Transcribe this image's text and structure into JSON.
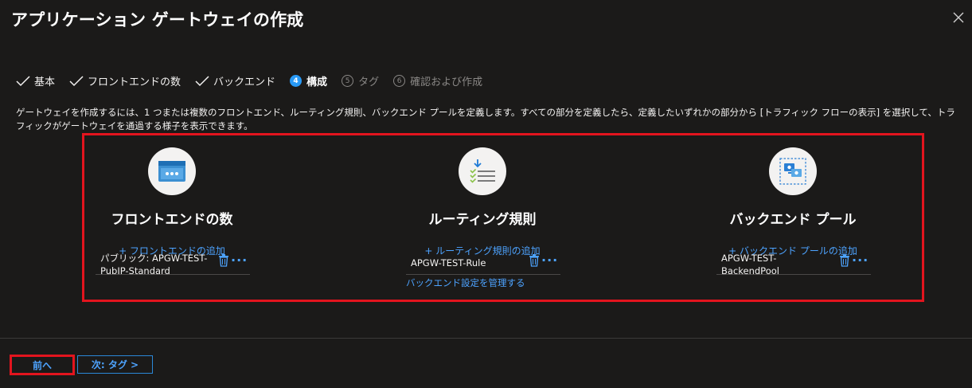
{
  "header": {
    "title": "アプリケーション ゲートウェイの作成",
    "more": "···"
  },
  "steps": [
    {
      "label": "基本",
      "state": "completed"
    },
    {
      "label": "フロントエンドの数",
      "state": "completed"
    },
    {
      "label": "バックエンド",
      "state": "completed"
    },
    {
      "num": "4",
      "label": "構成",
      "state": "active"
    },
    {
      "num": "5",
      "label": "タグ",
      "state": "disabled"
    },
    {
      "num": "6",
      "label": "確認および作成",
      "state": "disabled"
    }
  ],
  "description": "ゲートウェイを作成するには、1 つまたは複数のフロントエンド、ルーティング規則、バックエンド プールを定義します。すべての部分を定義したら、定義したいずれかの部分から [トラフィック フローの表示] を選択して、トラフィックがゲートウェイを通過する様子を表示できます。",
  "frontend": {
    "title": "フロントエンドの数",
    "add": "+ フロントエンドの追加",
    "item": "パブリック: APGW-TEST-PubIP-Standard",
    "icon": "frontend-window-icon"
  },
  "routing": {
    "title": "ルーティング規則",
    "add": "+ ルーティング規則の追加",
    "item": "APGW-TEST-Rule",
    "manage": "バックエンド設定を管理する",
    "icon": "routing-rules-icon"
  },
  "backend": {
    "title": "バックエンド プール",
    "add": "+ バックエンド プールの追加",
    "item": "APGW-TEST-BackendPool",
    "icon": "backend-pool-icon"
  },
  "more_actions": "···",
  "footer": {
    "prev": "前へ",
    "next": "次: タグ >"
  },
  "colors": {
    "accent": "#4da3ff",
    "highlight": "#e3141e",
    "background": "#1b1a19"
  }
}
